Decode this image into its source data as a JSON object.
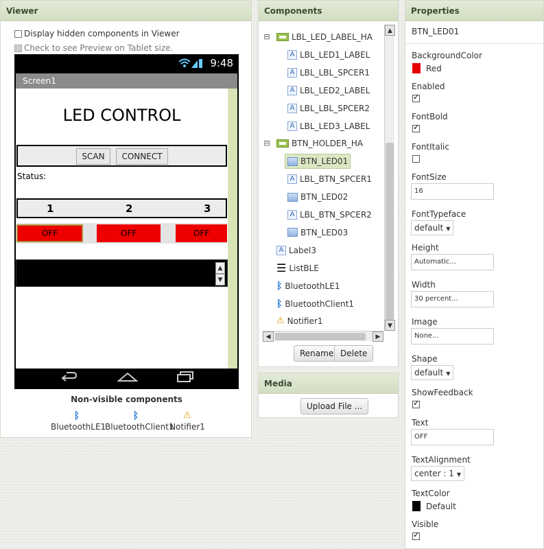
{
  "viewer": {
    "header": "Viewer",
    "display_hidden_label": "Display hidden components in Viewer",
    "tablet_preview_label": "Check to see Preview on Tablet size.",
    "phone": {
      "time": "9:48",
      "screen_title": "Screen1",
      "app_title": "LED CONTROL",
      "scan_label": "SCAN",
      "connect_label": "CONNECT",
      "status_label": "Status:",
      "numbers": [
        "1",
        "2",
        "3"
      ],
      "off_labels": [
        "OFF",
        "OFF",
        "OFF"
      ],
      "off_color": "#ee0000"
    },
    "nonvisible_title": "Non-visible components",
    "nonvisible": [
      {
        "label": "BluetoothLE1",
        "icon": "bluetooth-icon"
      },
      {
        "label": "BluetoothClient1",
        "icon": "bluetooth-icon"
      },
      {
        "label": "Notifier1",
        "icon": "warning-icon"
      }
    ]
  },
  "components": {
    "header": "Components",
    "tree": [
      {
        "label": "LBL_LED_LABEL_HA",
        "icon": "horizontal-arrangement-icon",
        "collapse": "⊟"
      },
      {
        "label": "LBL_LED1_LABEL",
        "icon": "label-icon"
      },
      {
        "label": "LBL_LBL_SPCER1",
        "icon": "label-icon"
      },
      {
        "label": "LBL_LED2_LABEL",
        "icon": "label-icon"
      },
      {
        "label": "LBL_LBL_SPCER2",
        "icon": "label-icon"
      },
      {
        "label": "LBL_LED3_LABEL",
        "icon": "label-icon"
      },
      {
        "label": "BTN_HOLDER_HA",
        "icon": "horizontal-arrangement-icon",
        "collapse": "⊟"
      },
      {
        "label": "BTN_LED01",
        "icon": "button-icon",
        "selected": true
      },
      {
        "label": "LBL_BTN_SPCER1",
        "icon": "label-icon"
      },
      {
        "label": "BTN_LED02",
        "icon": "button-icon"
      },
      {
        "label": "LBL_BTN_SPCER2",
        "icon": "label-icon"
      },
      {
        "label": "BTN_LED03",
        "icon": "button-icon"
      },
      {
        "label": "Label3",
        "icon": "label-icon"
      },
      {
        "label": "ListBLE",
        "icon": "listview-icon"
      },
      {
        "label": "BluetoothLE1",
        "icon": "bluetooth-icon"
      },
      {
        "label": "BluetoothClient1",
        "icon": "bluetooth-icon"
      },
      {
        "label": "Notifier1",
        "icon": "warning-icon"
      }
    ],
    "rename_label": "Rename",
    "delete_label": "Delete"
  },
  "media": {
    "header": "Media",
    "upload_label": "Upload File ..."
  },
  "properties": {
    "header": "Properties",
    "component": "BTN_LED01",
    "background_color_label": "BackgroundColor",
    "background_color_value": "Red",
    "background_color_hex": "#e60000",
    "enabled_label": "Enabled",
    "enabled": true,
    "fontbold_label": "FontBold",
    "fontbold": true,
    "fontitalic_label": "FontItalic",
    "fontitalic": false,
    "fontsize_label": "FontSize",
    "fontsize_value": "16",
    "fonttypeface_label": "FontTypeface",
    "fonttypeface_value": "default",
    "height_label": "Height",
    "height_value": "Automatic...",
    "width_label": "Width",
    "width_value": "30 percent...",
    "image_label": "Image",
    "image_value": "None...",
    "shape_label": "Shape",
    "shape_value": "default",
    "showfeedback_label": "ShowFeedback",
    "showfeedback": true,
    "text_label": "Text",
    "text_value": "OFF",
    "textalignment_label": "TextAlignment",
    "textalignment_value": "center : 1",
    "textcolor_label": "TextColor",
    "textcolor_value": "Default",
    "textcolor_hex": "#000000",
    "visible_label": "Visible",
    "visible": true
  }
}
